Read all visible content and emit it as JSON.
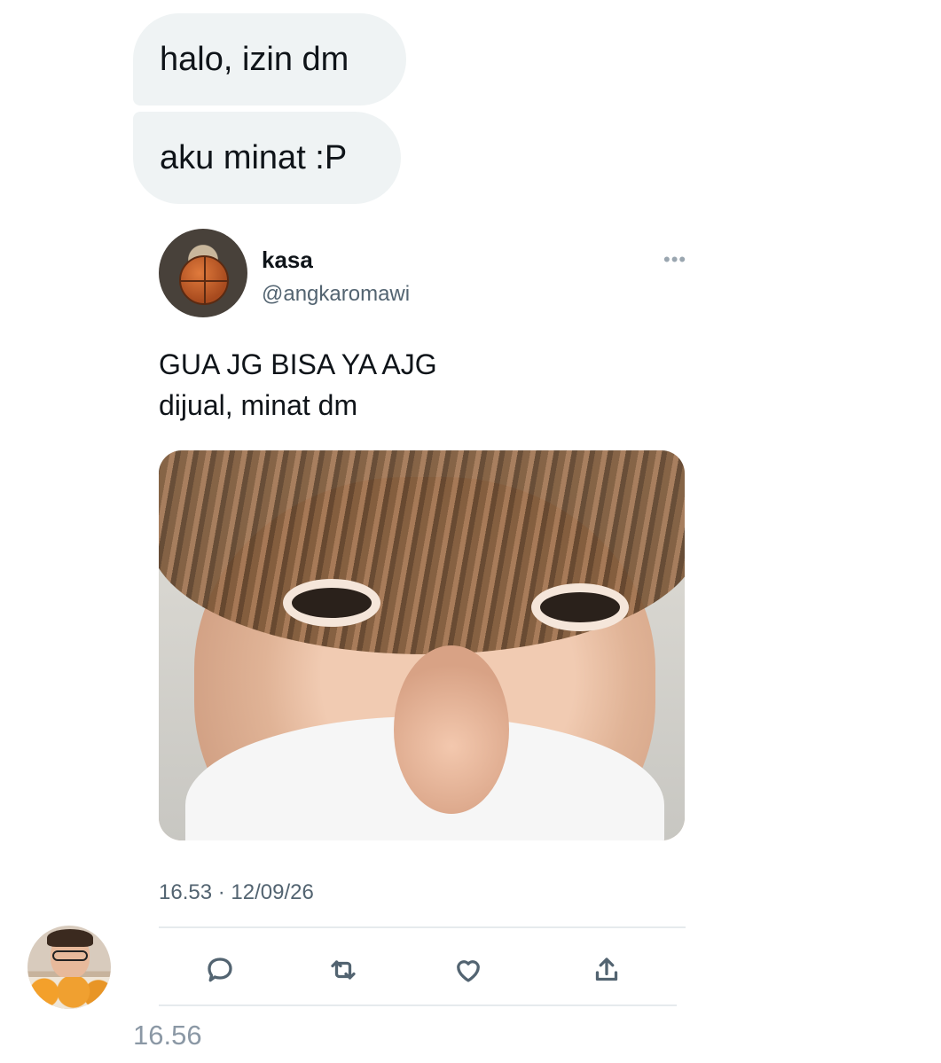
{
  "messages": [
    {
      "text": "halo, izin dm"
    },
    {
      "text": "aku minat :P"
    }
  ],
  "tweet": {
    "display_name": "kasa",
    "handle": "@angkaromawi",
    "more_icon": "ellipsis-icon",
    "text_lines": [
      "GUA JG BISA YA AJG",
      "dijual, minat dm"
    ],
    "timestamp": "16.53 · 12/09/26",
    "actions": [
      "reply-icon",
      "retweet-icon",
      "like-icon",
      "share-icon"
    ]
  },
  "message_time": "16.56",
  "colors": {
    "bubble_bg": "#eff3f4",
    "secondary_text": "#536471",
    "timestamp_gray": "#8b98a5"
  }
}
